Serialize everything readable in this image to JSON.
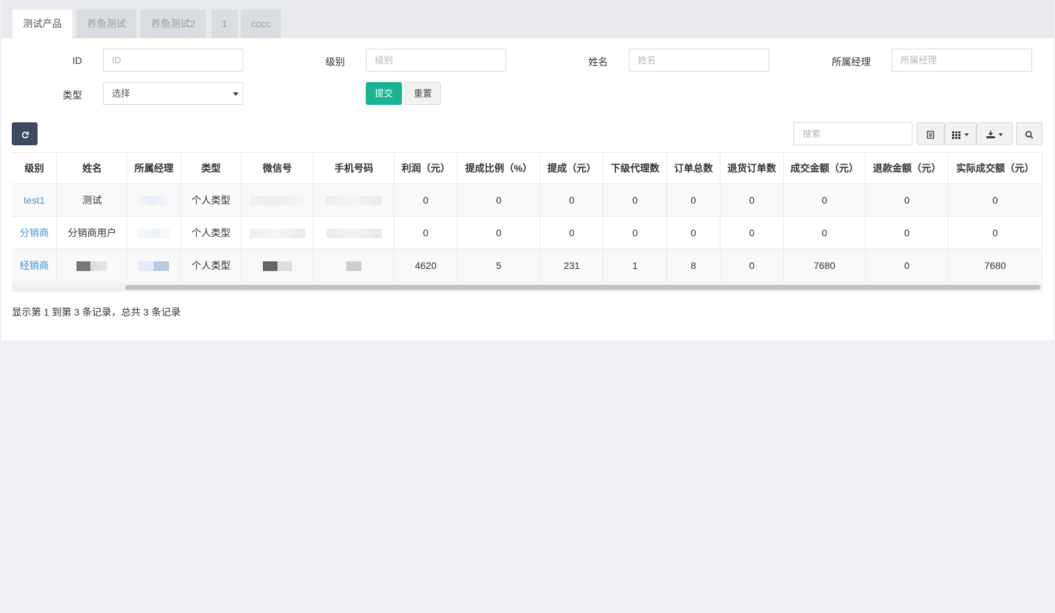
{
  "tabs": [
    {
      "label": "测试产品",
      "active": true
    },
    {
      "label": "养鱼测试",
      "active": false
    },
    {
      "label": "养鱼测试2",
      "active": false
    },
    {
      "label": "1",
      "active": false
    },
    {
      "label": "cccc",
      "active": false
    }
  ],
  "filters": {
    "id": {
      "label": "ID",
      "placeholder": "ID"
    },
    "level": {
      "label": "级别",
      "placeholder": "级别"
    },
    "name": {
      "label": "姓名",
      "placeholder": "姓名"
    },
    "manager": {
      "label": "所属经理",
      "placeholder": "所属经理"
    },
    "type": {
      "label": "类型",
      "value": "选择"
    },
    "submit_label": "提交",
    "reset_label": "重置"
  },
  "toolbar": {
    "refresh_icon": "refresh-icon",
    "search_placeholder": "搜索",
    "toggle_icon": "list-toggle-icon",
    "columns_icon": "grid-columns-icon",
    "export_icon": "export-icon",
    "search_icon": "search-icon"
  },
  "table": {
    "columns": [
      "级别",
      "姓名",
      "所属经理",
      "类型",
      "微信号",
      "手机号码",
      "利润（元）",
      "提成比例（%）",
      "提成（元）",
      "下级代理数",
      "订单总数",
      "退货订单数",
      "成交金额（元）",
      "退款金额（元）",
      "实际成交额（元）"
    ],
    "rows": [
      {
        "level": "test1",
        "name": "测试",
        "manager": "",
        "type": "个人类型",
        "wechat": "",
        "phone": "",
        "profit": "0",
        "rate": "0",
        "commission": "0",
        "sub_agents": "0",
        "orders": "0",
        "returns": "0",
        "deal_amount": "0",
        "refund": "0",
        "actual": "0"
      },
      {
        "level": "分销商",
        "name": "分销商用户",
        "manager": "",
        "type": "个人类型",
        "wechat": "",
        "phone": "",
        "profit": "0",
        "rate": "0",
        "commission": "0",
        "sub_agents": "0",
        "orders": "0",
        "returns": "0",
        "deal_amount": "0",
        "refund": "0",
        "actual": "0"
      },
      {
        "level": "经销商",
        "name": "",
        "manager": "",
        "type": "个人类型",
        "wechat": "",
        "phone": "",
        "profit": "4620",
        "rate": "5",
        "commission": "231",
        "sub_agents": "1",
        "orders": "8",
        "returns": "0",
        "deal_amount": "7680",
        "refund": "0",
        "actual": "7680"
      }
    ]
  },
  "pagination": {
    "summary": "显示第 1 到第 3 条记录，总共 3 条记录"
  },
  "colors": {
    "primary": "#1ab394",
    "link": "#4a90d9",
    "dark_button": "#3d4a60"
  }
}
